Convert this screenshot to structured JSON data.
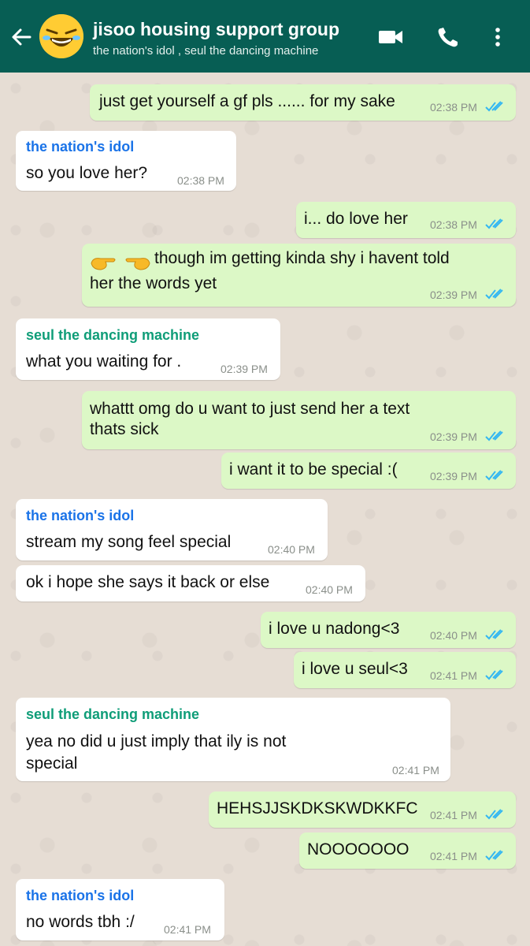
{
  "header": {
    "title": "jisoo housing support group",
    "subtitle": "the nation's idol , seul the dancing machine",
    "colors": {
      "bar": "#075e54",
      "outgoing": "#dcf8c6",
      "incoming": "#ffffff",
      "ticks": "#34b7f1"
    }
  },
  "messages": [
    {
      "dir": "out",
      "text": "just get yourself a gf pls ...... for my sake",
      "time": "02:38 PM",
      "ticks": "read"
    },
    {
      "dir": "in",
      "sender": "the nation's idol",
      "text": "so you love her?",
      "time": "02:38 PM"
    },
    {
      "dir": "out",
      "text": "i... do love her",
      "time": "02:38 PM",
      "ticks": "read"
    },
    {
      "dir": "out",
      "emoji": "pointing-hands",
      "text_line1": "though im getting kinda shy i havent told",
      "text_line2": "her the words yet",
      "time": "02:39 PM",
      "ticks": "read"
    },
    {
      "dir": "in",
      "sender": "seul the dancing machine",
      "text": "what you waiting for .",
      "time": "02:39 PM"
    },
    {
      "dir": "out",
      "text_line1": "whattt omg do u want to just send her a text",
      "text_line2": "thats sick",
      "time": "02:39 PM",
      "ticks": "read"
    },
    {
      "dir": "out",
      "text": "i want it to be special :(",
      "time": "02:39 PM",
      "ticks": "read"
    },
    {
      "dir": "in",
      "sender": "the nation's idol",
      "text": "stream my song feel special",
      "time": "02:40 PM"
    },
    {
      "dir": "in",
      "text": "ok i hope she says it back or else",
      "time": "02:40 PM"
    },
    {
      "dir": "out",
      "text": "i love u nadong<3",
      "time": "02:40 PM",
      "ticks": "read"
    },
    {
      "dir": "out",
      "text": "i love u seul<3",
      "time": "02:41 PM",
      "ticks": "read"
    },
    {
      "dir": "in",
      "sender": "seul the dancing machine",
      "text_line1": "yea no did u just imply that ily is not",
      "text_line2": "special",
      "time": "02:41 PM"
    },
    {
      "dir": "out",
      "text": "HEHSJJSKDKSKWDKKFC",
      "time": "02:41 PM",
      "ticks": "read"
    },
    {
      "dir": "out",
      "text": "NOOOOOOO",
      "time": "02:41 PM",
      "ticks": "read"
    },
    {
      "dir": "in",
      "sender": "the nation's idol",
      "text": "no words tbh :/",
      "time": "02:41 PM"
    }
  ]
}
